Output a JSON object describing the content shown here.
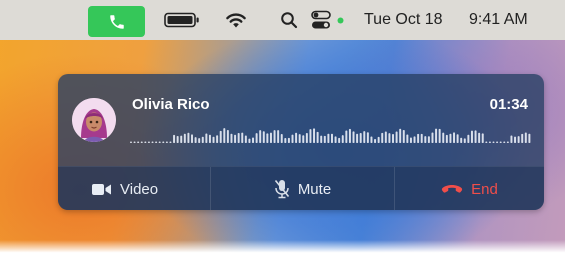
{
  "menubar": {
    "icons": [
      "phone-icon",
      "battery-icon",
      "wifi-icon",
      "search-icon",
      "control-center-icon",
      "mic-in-use-dot"
    ],
    "date": "Tue Oct 18",
    "time": "9:41 AM",
    "call_indicator_color": "#35c759"
  },
  "call": {
    "caller_name": "Olivia Rico",
    "duration": "01:34",
    "actions": [
      {
        "label": "Video",
        "icon": "video-camera-icon"
      },
      {
        "label": "Mute",
        "icon": "microphone-slash-icon"
      },
      {
        "label": "End",
        "icon": "phone-hangup-icon",
        "color": "#f04e4a"
      }
    ]
  }
}
